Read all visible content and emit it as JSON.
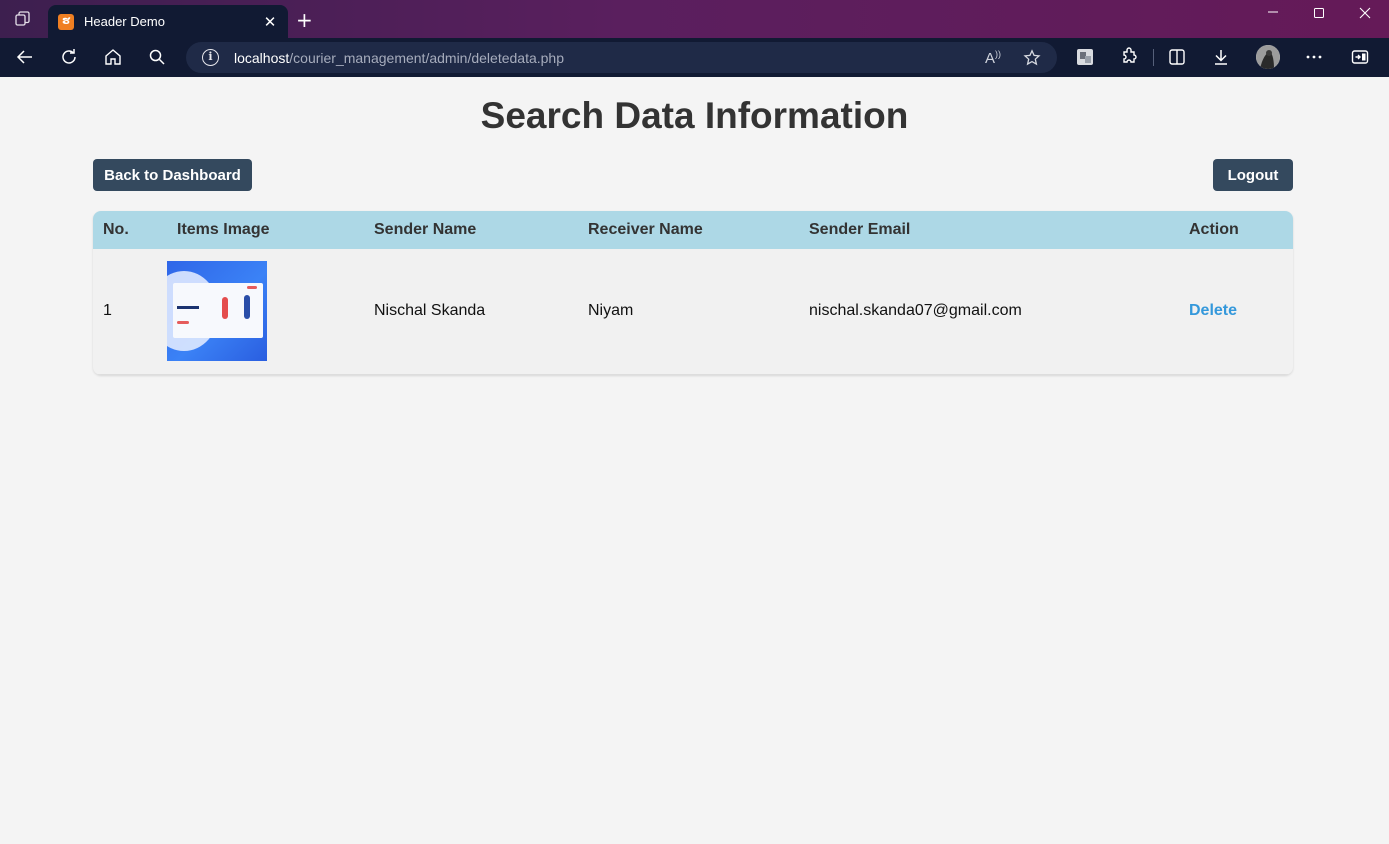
{
  "browser": {
    "tab_title": "Header Demo",
    "tab_favicon_glyph": "ຮ",
    "url_host": "localhost",
    "url_path": "/courier_management/admin/deletedata.php",
    "read_aloud_glyph": "A",
    "icons": [
      "workspaces-icon",
      "tab-favicon-icon",
      "tab-close-icon",
      "new-tab-icon",
      "minimize-icon",
      "maximize-icon",
      "close-window-icon",
      "back-icon",
      "refresh-icon",
      "home-icon",
      "search-icon",
      "site-info-icon",
      "read-aloud-icon",
      "favorite-icon",
      "extension-photo-icon",
      "extensions-icon",
      "split-screen-icon",
      "downloads-icon",
      "profile-avatar-icon",
      "more-icon",
      "sidebar-icon"
    ]
  },
  "page": {
    "title": "Search Data Information",
    "back_button": "Back to Dashboard",
    "logout_button": "Logout"
  },
  "table": {
    "headers": [
      "No.",
      "Items Image",
      "Sender Name",
      "Receiver Name",
      "Sender Email",
      "Action"
    ],
    "rows": [
      {
        "no": "1",
        "sender_name": "Nischal Skanda",
        "receiver_name": "Niyam",
        "sender_email": "nischal.skanda07@gmail.com",
        "action": "Delete"
      }
    ]
  },
  "colors": {
    "header_bg": "#add8e6",
    "button_bg": "#34495e",
    "link": "#3498db",
    "page_bg": "#f4f4f4",
    "browser_bar": "#111a33"
  }
}
